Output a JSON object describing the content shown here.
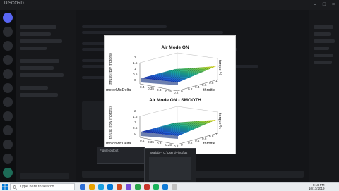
{
  "app": {
    "title": "DISCORD",
    "window_title": ""
  },
  "sidebar": {
    "header": ""
  },
  "main": {
    "channel": ""
  },
  "figure": {
    "plots": [
      {
        "title": "Air Mode ON",
        "zlabel": "thrust (fbw motors)",
        "xlabel": "motorMixDelta",
        "ylabel": "throttle",
        "right_label": "torque %",
        "zticks": [
          "2",
          "1.5",
          "1",
          "0.5",
          "0"
        ],
        "xticks": [
          "0.4",
          "0.35",
          "0.3",
          "0.25",
          "0.2"
        ],
        "yticks": [
          "0",
          "0.2",
          "0.4",
          "0.6",
          "0.8",
          "1"
        ]
      },
      {
        "title": "Air Mode ON - SMOOTH",
        "zlabel": "thrust (fbw motors)",
        "xlabel": "motorMixDelta",
        "ylabel": "throttle",
        "right_label": "torque %",
        "zticks": [
          "2",
          "1.5",
          "1",
          "0.5",
          "0"
        ],
        "xticks": [
          "0.4",
          "0.35",
          "0.3",
          "0.25",
          "0.2"
        ],
        "yticks": [
          "0",
          "0.2",
          "0.4",
          "0.6",
          "0.8",
          "1"
        ]
      }
    ]
  },
  "popups": {
    "left_title": "Figure output",
    "preview_title": "Matlab -- C:\\Users\\Vinc\\figs"
  },
  "taskbar": {
    "search_placeholder": "Type here to search",
    "time": "6:16 PM",
    "date": "10/17/2019",
    "icon_colors": [
      "#2f6fd6",
      "#e8a200",
      "#1aa0e0",
      "#0078d7",
      "#d04a1f",
      "#7b4ed8",
      "#2aa44a",
      "#c7352b",
      "#18b35b",
      "#0f7ad6",
      "#c0c0c0"
    ]
  }
}
